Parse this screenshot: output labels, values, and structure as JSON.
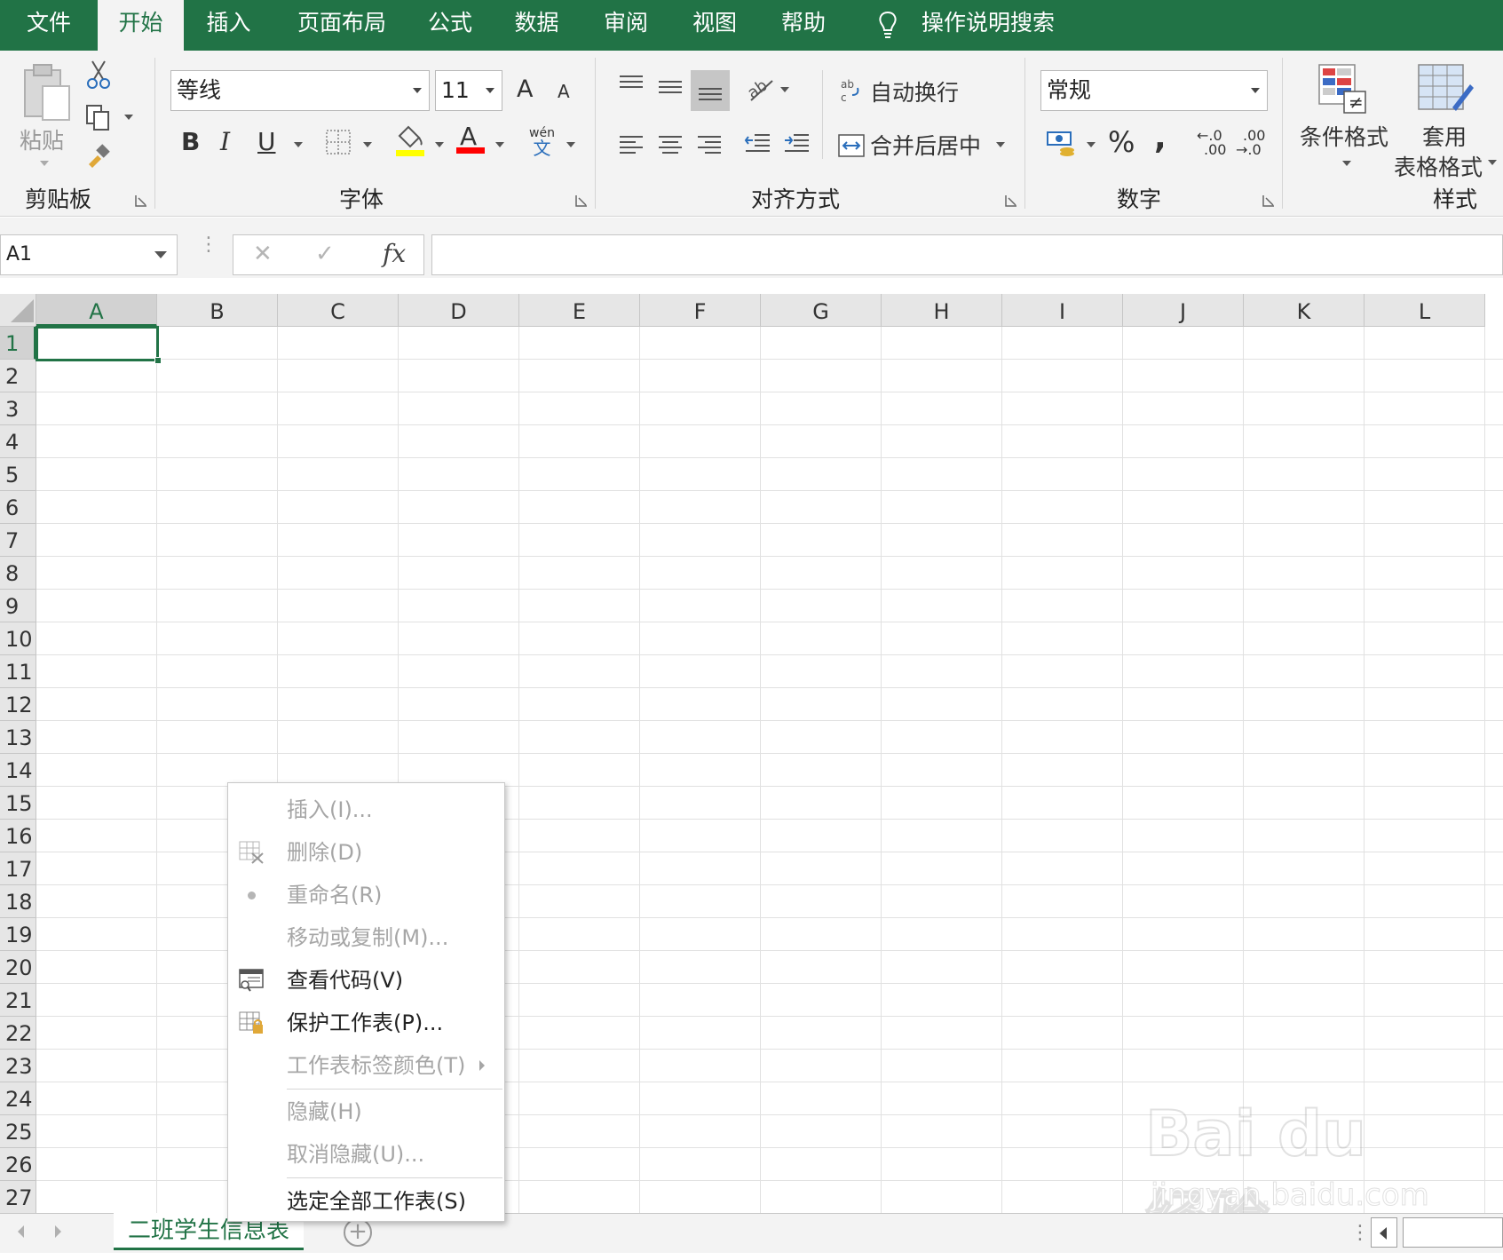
{
  "tabs": {
    "file": "文件",
    "home": "开始",
    "insert": "插入",
    "page_layout": "页面布局",
    "formulas": "公式",
    "data": "数据",
    "review": "审阅",
    "view": "视图",
    "help": "帮助",
    "search": "操作说明搜索"
  },
  "ribbon": {
    "clipboard": {
      "paste": "粘贴",
      "label": "剪贴板"
    },
    "font": {
      "name": "等线",
      "size": "11",
      "bold": "B",
      "italic": "I",
      "underline": "U",
      "grow": "A",
      "shrink": "A",
      "phonetic_top": "wén",
      "phonetic_bottom": "文",
      "label": "字体",
      "fill_color": "#ffff00",
      "font_color": "#ff0000"
    },
    "alignment": {
      "wrap": "自动换行",
      "merge": "合并后居中",
      "label": "对齐方式"
    },
    "number": {
      "format": "常规",
      "percent": "%",
      "comma": ",",
      "inc_top": "←.0",
      "inc_bottom": ".00",
      "dec_top": ".00",
      "dec_bottom": "→.0",
      "label": "数字"
    },
    "styles": {
      "conditional": "条件格式",
      "table_line1": "套用",
      "table_line2": "表格格式",
      "label": "样式"
    }
  },
  "formula_bar": {
    "name_box": "A1",
    "cancel": "✕",
    "enter": "✓",
    "fx": "fx",
    "value": ""
  },
  "grid": {
    "columns": [
      "A",
      "B",
      "C",
      "D",
      "E",
      "F",
      "G",
      "H",
      "I",
      "J",
      "K",
      "L"
    ],
    "rows": [
      "1",
      "2",
      "3",
      "4",
      "5",
      "6",
      "7",
      "8",
      "9",
      "10",
      "11",
      "12",
      "13",
      "14",
      "15",
      "16",
      "17",
      "18",
      "19",
      "20",
      "21",
      "22",
      "23",
      "24",
      "25",
      "26",
      "27"
    ],
    "active_cell": "A1"
  },
  "context_menu": {
    "items": [
      {
        "label": "插入(I)...",
        "enabled": false
      },
      {
        "label": "删除(D)",
        "enabled": false
      },
      {
        "label": "重命名(R)",
        "enabled": false
      },
      {
        "label": "移动或复制(M)...",
        "enabled": false
      },
      {
        "label": "查看代码(V)",
        "enabled": true
      },
      {
        "label": "保护工作表(P)...",
        "enabled": true
      },
      {
        "label": "工作表标签颜色(T)",
        "enabled": false
      },
      {
        "label": "隐藏(H)",
        "enabled": false
      },
      {
        "label": "取消隐藏(U)...",
        "enabled": false
      },
      {
        "label": "选定全部工作表(S)",
        "enabled": true
      }
    ]
  },
  "sheets": {
    "active": "二班学生信息表",
    "add": "+"
  },
  "watermark": {
    "line1": "Bai du 经验",
    "line2": "jingyan.baidu.com"
  },
  "colors": {
    "accent": "#217346",
    "ribbon_bg": "#f3f3f3",
    "disabled_text": "#a6a6a6"
  }
}
